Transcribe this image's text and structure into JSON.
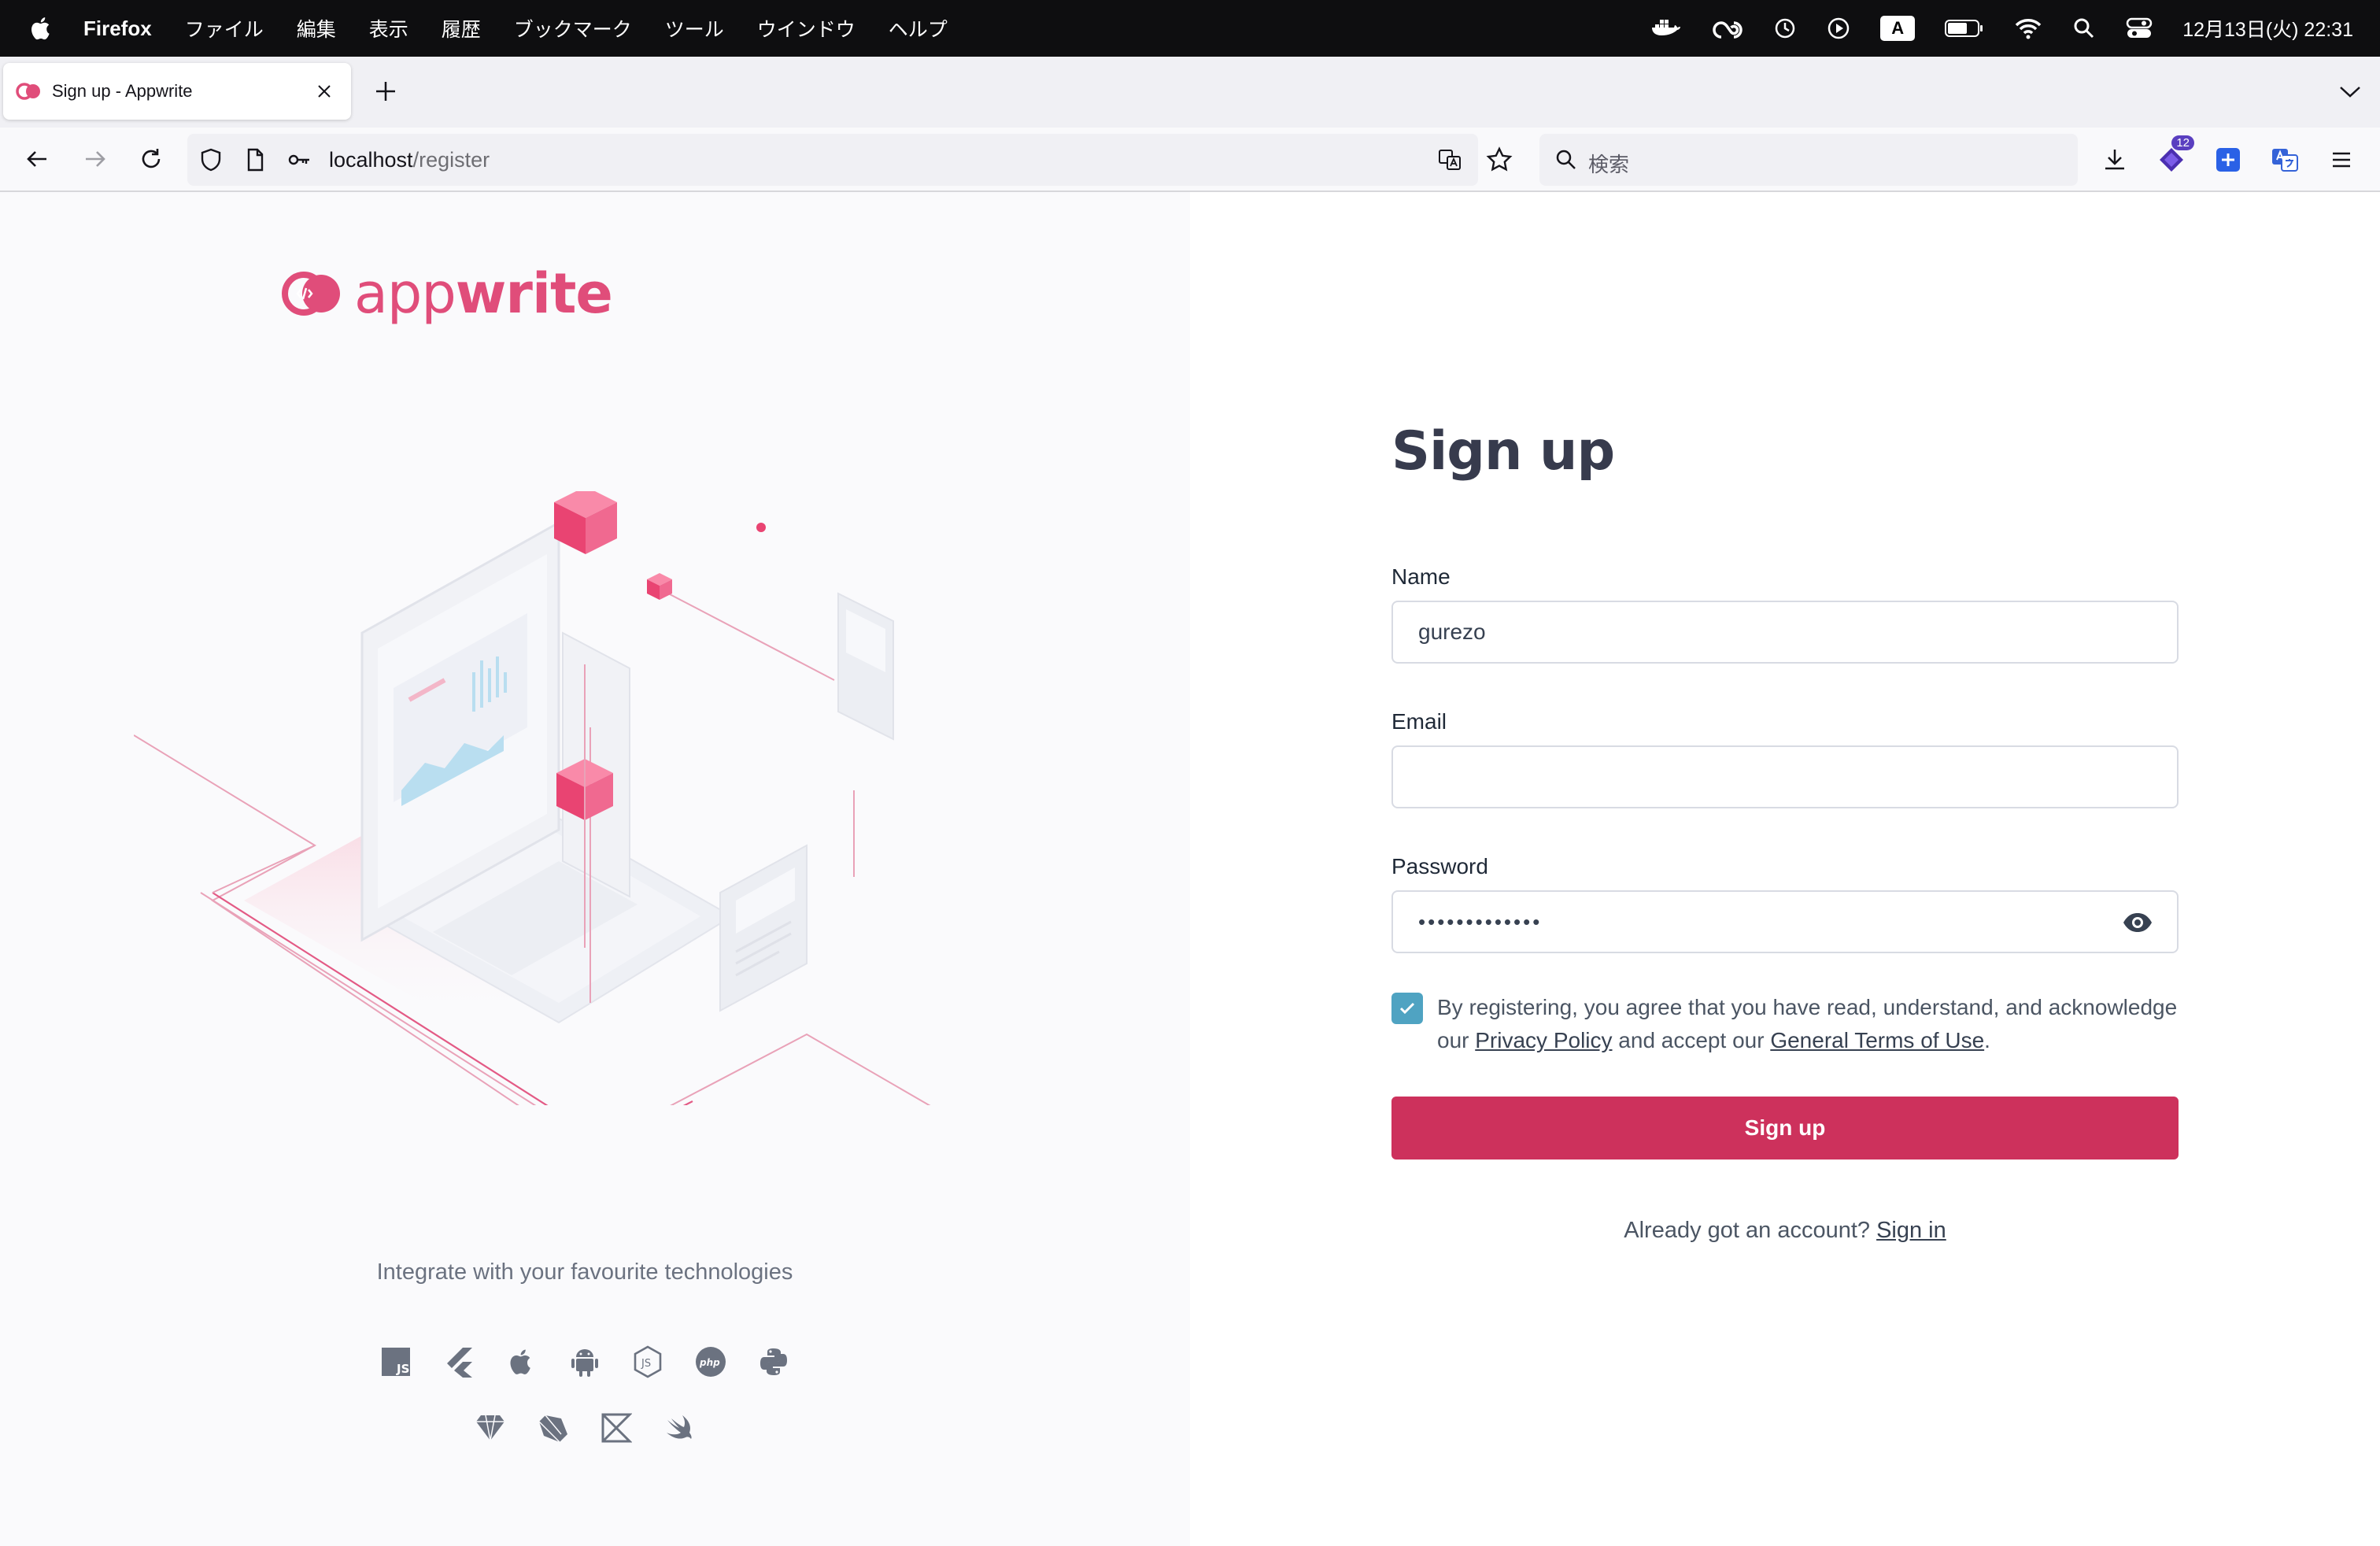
{
  "menubar": {
    "app": "Firefox",
    "items": [
      "ファイル",
      "編集",
      "表示",
      "履歴",
      "ブックマーク",
      "ツール",
      "ウインドウ",
      "ヘルプ"
    ],
    "input_mode": "A",
    "clock": "12月13日(火) 22:31"
  },
  "browser": {
    "tab_title": "Sign up - Appwrite",
    "url_host": "localhost",
    "url_path": "/register",
    "search_placeholder": "検索",
    "extension_badge": "12"
  },
  "brand": {
    "logo_left": "app",
    "logo_right": "write",
    "accent": "#e04d7a"
  },
  "left": {
    "integrate_text": "Integrate with your favourite technologies",
    "tech_icons_row1": [
      "javascript-icon",
      "flutter-icon",
      "apple-icon",
      "android-icon",
      "nodejs-icon",
      "php-icon",
      "python-icon"
    ],
    "tech_icons_row2": [
      "ruby-icon",
      "dart-icon",
      "kotlin-icon",
      "swift-icon"
    ]
  },
  "form": {
    "heading": "Sign up",
    "name_label": "Name",
    "name_value": "gurezo",
    "email_label": "Email",
    "email_value": "",
    "password_label": "Password",
    "password_value": "•••••••••••••",
    "agree_checked": true,
    "agree_prefix": "By registering, you agree that you have read, understand, and acknowledge our ",
    "privacy_link": "Privacy Policy",
    "agree_middle": " and accept our ",
    "terms_link": "General Terms of Use",
    "agree_suffix": ".",
    "submit_label": "Sign up",
    "already_text": "Already got an account? ",
    "signin_link": "Sign in",
    "button_color": "#cd315c",
    "checkbox_color": "#4fa3c2"
  }
}
